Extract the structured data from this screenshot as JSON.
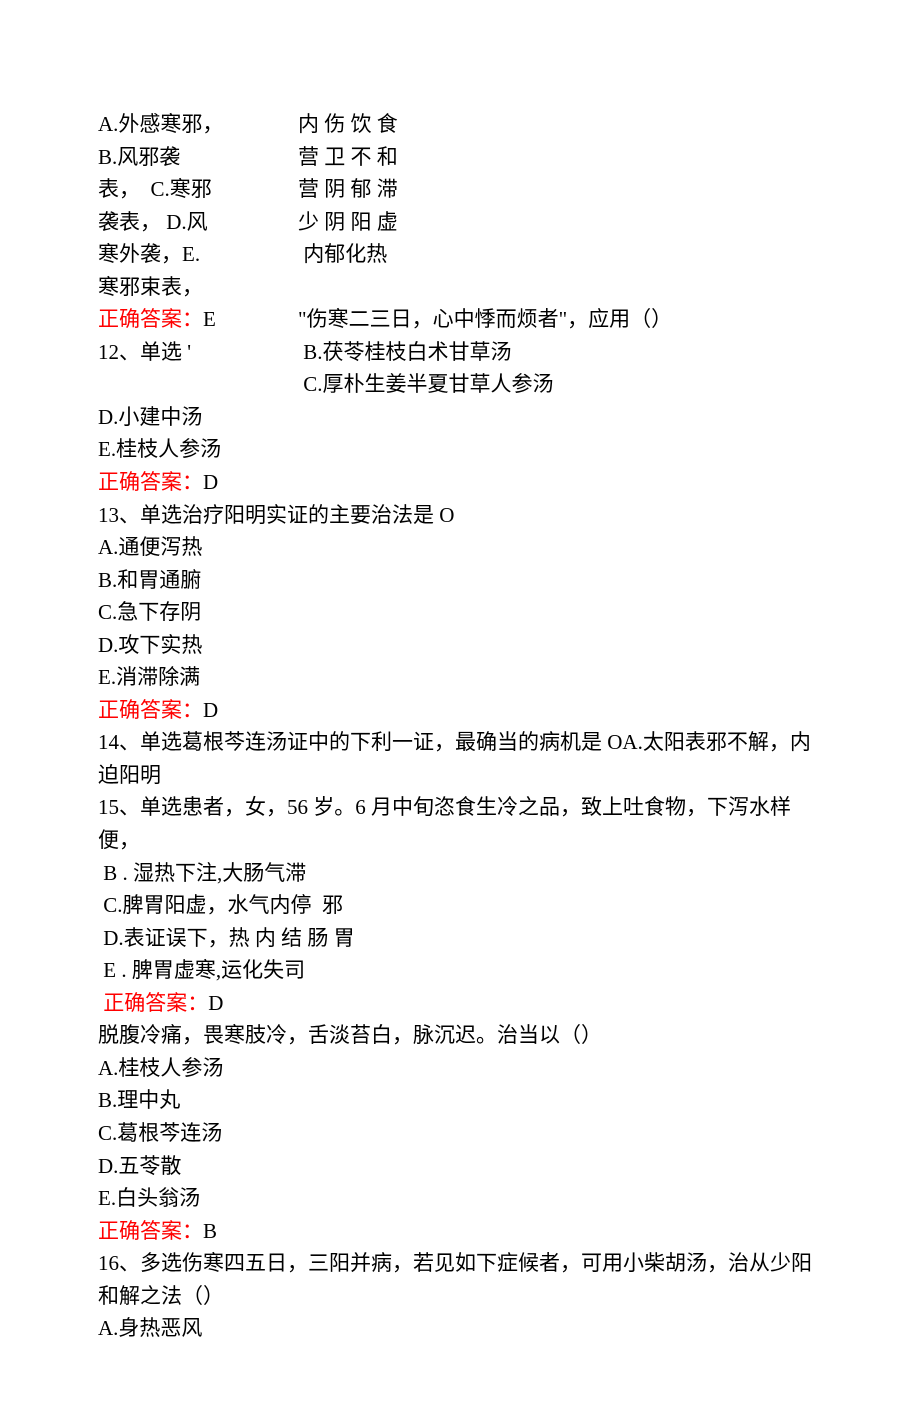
{
  "block1": {
    "left": [
      "A.外感寒邪，",
      "B.风邪袭",
      "表，  C.寒邪",
      "袭表， D.风",
      "寒外袭，E.",
      "寒邪束表，"
    ],
    "right": [
      "内 伤 饮 食",
      "营 卫 不 和",
      "营 阴 郁 滞",
      "少 阴 阳 虚",
      " 内郁化热"
    ]
  },
  "ans11_label": "正确答案：",
  "ans11_value": "E",
  "q12_row": {
    "left": "12、单选 '",
    "right1": "\"伤寒二三日，心中悸而烦者\"，应用（）",
    "right2": " B.茯苓桂枝白术甘草汤",
    "right3": " C.厚朴生姜半夏甘草人参汤"
  },
  "q12_d": "D.小建中汤",
  "q12_e": "E.桂枝人参汤",
  "ans12_label": "正确答案：",
  "ans12_value": "D",
  "q13": "13、单选治疗阳明实证的主要治法是 O",
  "q13_a": "A.通便泻热",
  "q13_b": "B.和胃通腑",
  "q13_c": "C.急下存阴",
  "q13_d": "D.攻下实热",
  "q13_e": "E.消滞除满",
  "ans13_label": "正确答案：",
  "ans13_value": "D",
  "q14": "14、单选葛根芩连汤证中的下利一证，最确当的病机是 OA.太阳表邪不解，内迫阳明",
  "q15": "15、单选患者，女，56 岁。6 月中旬恣食生冷之品，致上吐食物，下泻水样便，",
  "q14_b": " B . 湿热下注,大肠气滞",
  "q14_c": " C.脾胃阳虚，水气内停  邪",
  "q14_d": " D.表证误下，热 内 结 肠 胃",
  "q14_e": " E . 脾胃虚寒,运化失司",
  "ans14_label": " 正确答案：",
  "ans14_value": "D",
  "q15_cont": "脱腹冷痛，畏寒肢冷，舌淡苔白，脉沉迟。治当以（）",
  "q15_a": "A.桂枝人参汤",
  "q15_b": "B.理中丸",
  "q15_c": "C.葛根芩连汤",
  "q15_d": "D.五苓散",
  "q15_e": "E.白头翁汤",
  "ans15_label": "正确答案：",
  "ans15_value": "B",
  "q16": "16、多选伤寒四五日，三阳并病，若见如下症候者，可用小柴胡汤，治从少阳和解之法（）",
  "q16_a": "A.身热恶风"
}
